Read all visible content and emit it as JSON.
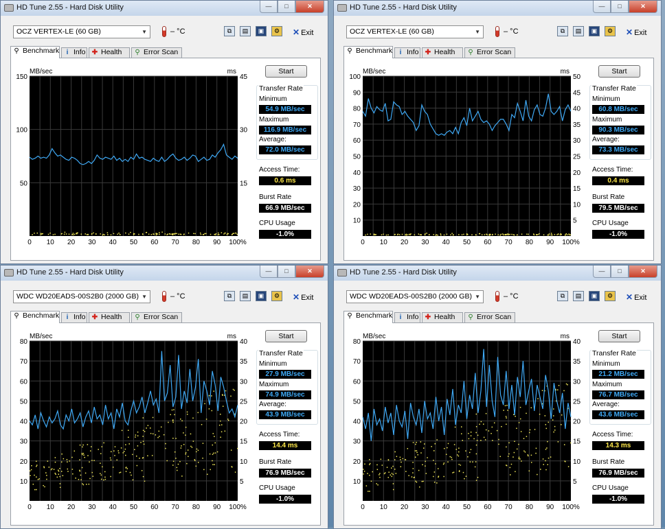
{
  "title": "HD Tune 2.55 - Hard Disk Utility",
  "window_controls": {
    "minimize": "—",
    "maximize": "□",
    "close": "✕"
  },
  "toolbar": {
    "temp": "– °C",
    "exit": "Exit"
  },
  "tabs": {
    "benchmark": "Benchmark",
    "info": "Info",
    "health": "Health",
    "error_scan": "Error Scan"
  },
  "start_label": "Start",
  "labels": {
    "transfer_rate": "Transfer Rate",
    "minimum": "Minimum",
    "maximum": "Maximum",
    "average": "Average:",
    "access_time": "Access Time:",
    "burst_rate": "Burst Rate",
    "cpu_usage": "CPU Usage"
  },
  "colors": {
    "transfer_line": "#3fa9f5",
    "access_dots": "#f2e85a",
    "chart_bg": "#000000",
    "grid": "#3a3a3a"
  },
  "windows": [
    {
      "drive": "OCZ VERTEX-LE (60 GB)",
      "stats": {
        "minimum": "54.9 MB/sec",
        "maximum": "116.9 MB/sec",
        "average": "72.0 MB/sec",
        "access_time": "0.6 ms",
        "burst_rate": "66.9 MB/sec",
        "cpu_usage": "-1.0%"
      }
    },
    {
      "drive": "OCZ VERTEX-LE (60 GB)",
      "stats": {
        "minimum": "60.8 MB/sec",
        "maximum": "90.3 MB/sec",
        "average": "73.3 MB/sec",
        "access_time": "0.4 ms",
        "burst_rate": "79.5 MB/sec",
        "cpu_usage": "-1.0%"
      }
    },
    {
      "drive": "WDC WD20EADS-00S2B0 (2000 GB)",
      "stats": {
        "minimum": "27.9 MB/sec",
        "maximum": "74.9 MB/sec",
        "average": "43.9 MB/sec",
        "access_time": "14.4 ms",
        "burst_rate": "76.9 MB/sec",
        "cpu_usage": "-1.0%"
      }
    },
    {
      "drive": "WDC WD20EADS-00S2B0 (2000 GB)",
      "stats": {
        "minimum": "21.2 MB/sec",
        "maximum": "76.7 MB/sec",
        "average": "43.6 MB/sec",
        "access_time": "14.3 ms",
        "burst_rate": "76.9 MB/sec",
        "cpu_usage": "-1.0%"
      }
    }
  ],
  "chart_data": [
    {
      "type": "line",
      "ylabel_left": "MB/sec",
      "ylabel_right": "ms",
      "ylim_left": [
        0,
        150
      ],
      "ylim_right": [
        0,
        45
      ],
      "left_ticks": [
        50,
        100,
        150
      ],
      "right_ticks": [
        15,
        30,
        45
      ],
      "x_ticks": [
        "0",
        "10",
        "20",
        "30",
        "40",
        "50",
        "60",
        "70",
        "80",
        "90",
        "100%"
      ],
      "series": [
        {
          "values": [
            74,
            72,
            73,
            75,
            73,
            74,
            73,
            76,
            82,
            78,
            75,
            76,
            74,
            72,
            71,
            74,
            73,
            71,
            68,
            67,
            68,
            70,
            68,
            71,
            76,
            73,
            72,
            74,
            73,
            72,
            75,
            71,
            73,
            70,
            72,
            70,
            74,
            72,
            77,
            73,
            74,
            72,
            71,
            70,
            73,
            71,
            70,
            74,
            70,
            72,
            75,
            77,
            73,
            71,
            72,
            74,
            71,
            73,
            76,
            75,
            70,
            72,
            74,
            71,
            72,
            76,
            74,
            78,
            81,
            86,
            76,
            74,
            72,
            75,
            73
          ]
        }
      ],
      "access_ms": [
        0.6,
        0.4,
        0.7,
        0.5,
        0.6,
        0.3,
        0.8,
        0.5,
        0.6,
        0.4,
        0.7,
        0.5
      ]
    },
    {
      "type": "line",
      "ylabel_left": "MB/sec",
      "ylabel_right": "ms",
      "ylim_left": [
        0,
        100
      ],
      "ylim_right": [
        0,
        50
      ],
      "left_ticks": [
        10,
        20,
        30,
        40,
        50,
        60,
        70,
        80,
        90,
        100
      ],
      "right_ticks": [
        5,
        10,
        15,
        20,
        25,
        30,
        35,
        40,
        45,
        50
      ],
      "x_ticks": [
        "0",
        "10",
        "20",
        "30",
        "40",
        "50",
        "60",
        "70",
        "80",
        "90",
        "100%"
      ],
      "series": [
        {
          "values": [
            78,
            75,
            86,
            80,
            77,
            81,
            79,
            78,
            83,
            72,
            73,
            84,
            82,
            81,
            76,
            78,
            75,
            73,
            71,
            66,
            69,
            82,
            78,
            76,
            70,
            67,
            64,
            63,
            64,
            63,
            65,
            66,
            64,
            68,
            64,
            71,
            74,
            69,
            80,
            72,
            75,
            78,
            73,
            71,
            72,
            70,
            66,
            69,
            71,
            73,
            73,
            70,
            66,
            76,
            74,
            83,
            78,
            72,
            85,
            75,
            72,
            79,
            82,
            76,
            75,
            80,
            89,
            78,
            76,
            78,
            81,
            72,
            79,
            82,
            78
          ]
        }
      ],
      "access_ms": [
        0.4,
        0.3,
        0.5,
        0.4,
        0.6,
        0.3,
        0.4,
        0.5,
        0.4,
        0.3,
        0.5,
        0.4
      ]
    },
    {
      "type": "line",
      "ylabel_left": "MB/sec",
      "ylabel_right": "ms",
      "ylim_left": [
        0,
        80
      ],
      "ylim_right": [
        0,
        40
      ],
      "left_ticks": [
        10,
        20,
        30,
        40,
        50,
        60,
        70,
        80
      ],
      "right_ticks": [
        5,
        10,
        15,
        20,
        25,
        30,
        35,
        40
      ],
      "x_ticks": [
        "0",
        "10",
        "20",
        "30",
        "40",
        "50",
        "60",
        "70",
        "80",
        "90",
        "100%"
      ],
      "series": [
        {
          "values": [
            40,
            38,
            43,
            36,
            44,
            40,
            37,
            42,
            39,
            41,
            45,
            38,
            36,
            43,
            40,
            46,
            39,
            41,
            44,
            37,
            42,
            45,
            39,
            47,
            41,
            43,
            38,
            48,
            41,
            44,
            36,
            46,
            42,
            49,
            40,
            38,
            45,
            50,
            44,
            47,
            52,
            44,
            49,
            55,
            48,
            51,
            44,
            75,
            50,
            54,
            68,
            47,
            52,
            73,
            46,
            55,
            49,
            66,
            50,
            57,
            71,
            44,
            60,
            55,
            48,
            65,
            58,
            45,
            62,
            57,
            50,
            44,
            46,
            42,
            48
          ]
        }
      ],
      "access_ms": [
        5,
        8,
        11,
        14,
        17,
        12,
        9,
        6,
        15,
        18,
        13,
        10,
        16,
        7,
        19,
        11,
        14,
        17,
        8,
        20
      ]
    },
    {
      "type": "line",
      "ylabel_left": "MB/sec",
      "ylabel_right": "ms",
      "ylim_left": [
        0,
        80
      ],
      "ylim_right": [
        0,
        40
      ],
      "left_ticks": [
        10,
        20,
        30,
        40,
        50,
        60,
        70,
        80
      ],
      "right_ticks": [
        5,
        10,
        15,
        20,
        25,
        30,
        35,
        40
      ],
      "x_ticks": [
        "0",
        "10",
        "20",
        "30",
        "40",
        "50",
        "60",
        "70",
        "80",
        "90",
        "100%"
      ],
      "series": [
        {
          "values": [
            42,
            36,
            44,
            30,
            46,
            38,
            41,
            35,
            47,
            39,
            44,
            33,
            48,
            40,
            37,
            45,
            31,
            49,
            42,
            38,
            46,
            34,
            50,
            41,
            44,
            36,
            52,
            40,
            47,
            33,
            51,
            43,
            56,
            38,
            48,
            44,
            60,
            41,
            53,
            46,
            64,
            44,
            55,
            76,
            47,
            68,
            50,
            42,
            72,
            53,
            48,
            65,
            46,
            58,
            43,
            62,
            52,
            70,
            48,
            55,
            61,
            45,
            58,
            52,
            46,
            63,
            55,
            41,
            59,
            50,
            44,
            54,
            36,
            49,
            42
          ]
        }
      ],
      "access_ms": [
        6,
        9,
        12,
        15,
        18,
        13,
        8,
        5,
        16,
        19,
        11,
        14,
        17,
        7,
        20,
        10,
        13,
        16,
        9,
        21
      ]
    }
  ]
}
